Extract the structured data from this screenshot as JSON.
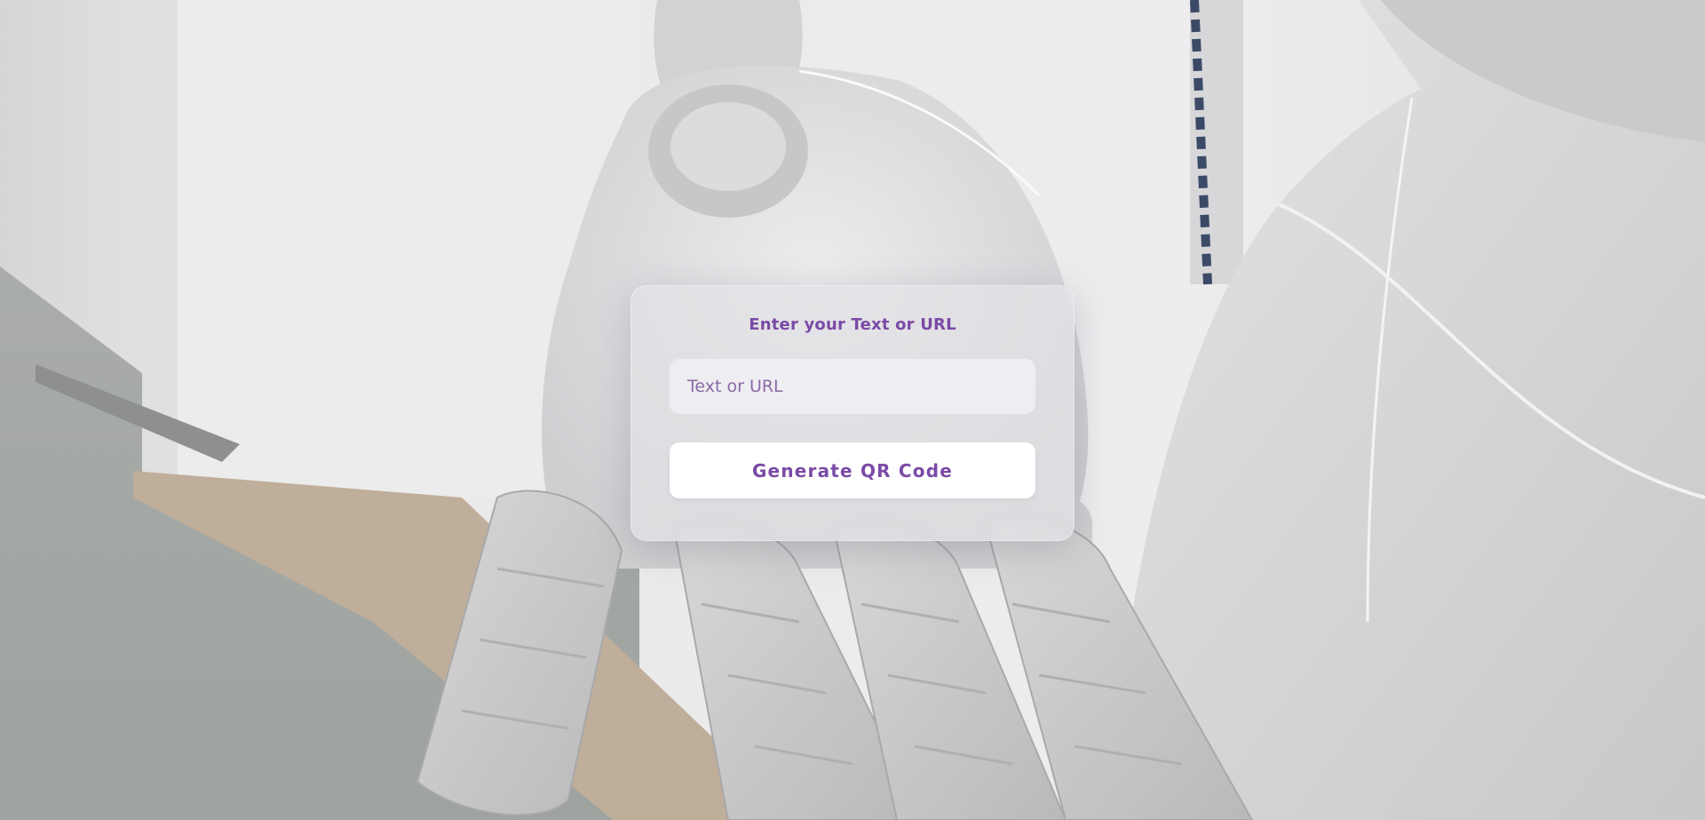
{
  "form": {
    "title": "Enter your Text or URL",
    "input_placeholder": "Text or URL",
    "input_value": "",
    "button_label": "Generate QR Code"
  },
  "colors": {
    "accent": "#7a4aa6",
    "card_background": "#e2e1e5",
    "button_background": "#ffffff"
  }
}
